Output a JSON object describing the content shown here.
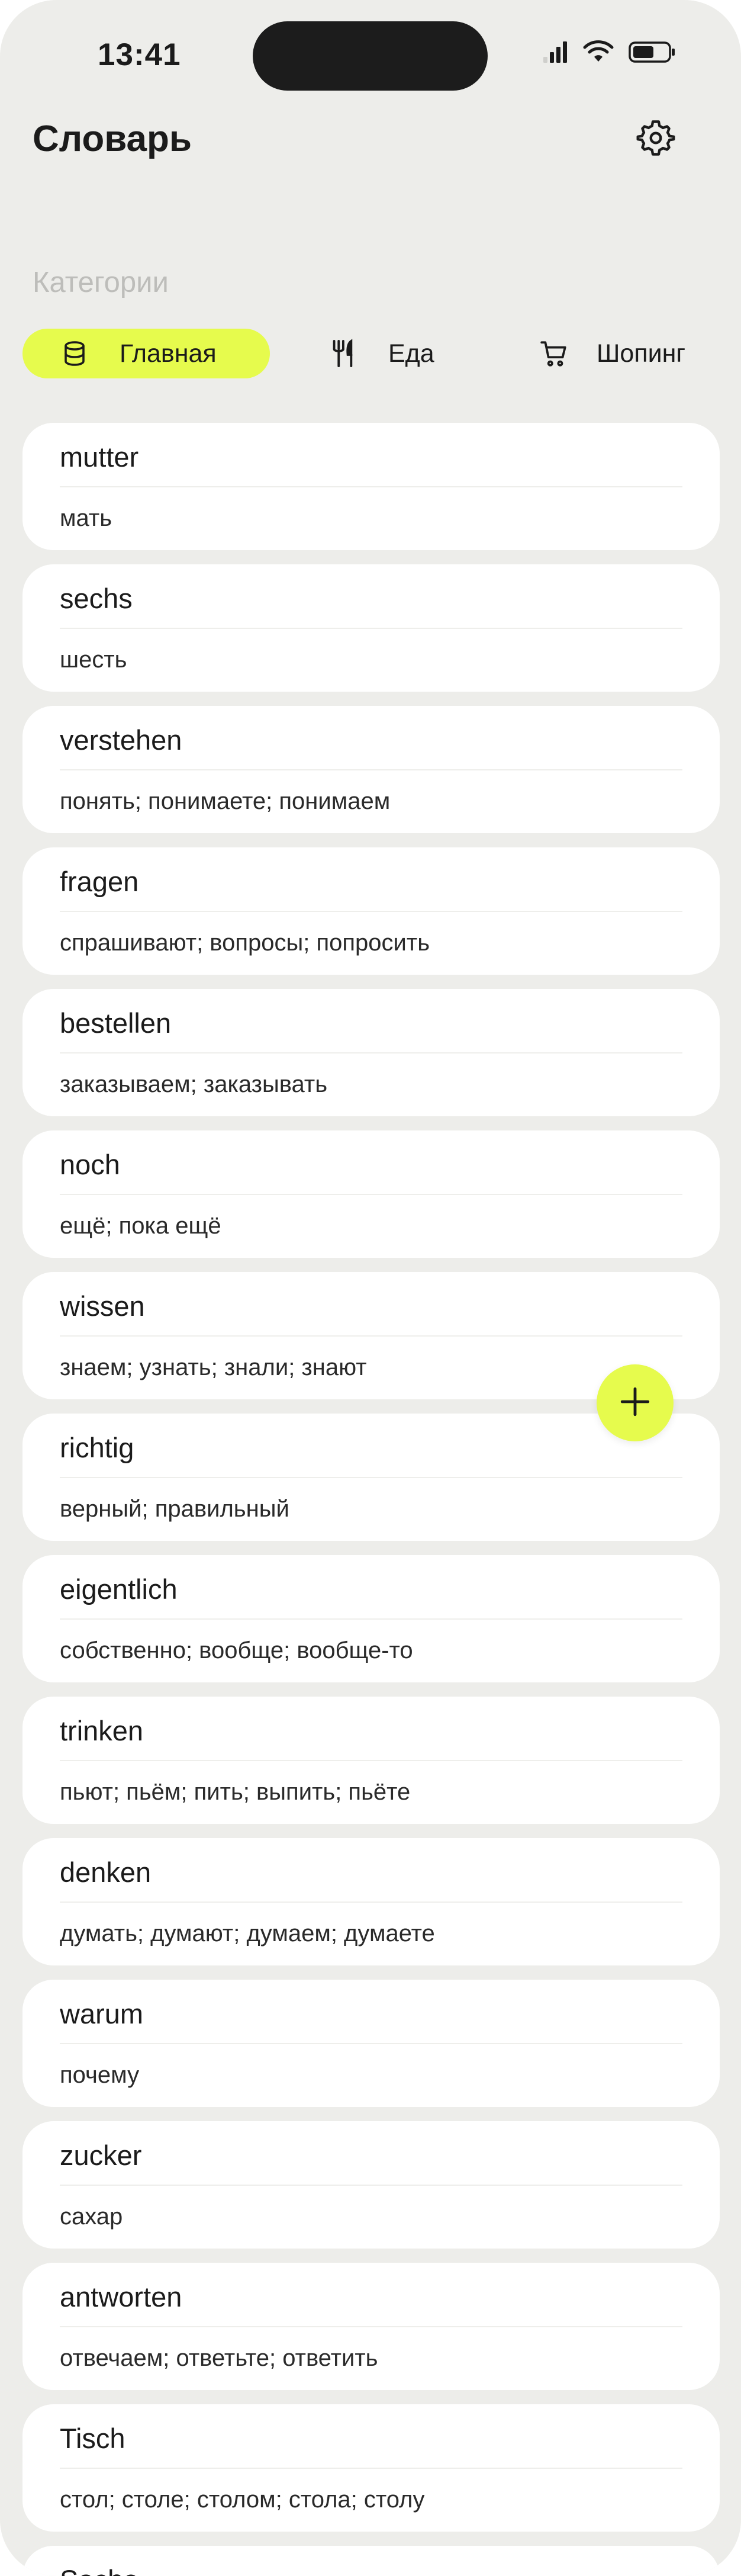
{
  "status_bar": {
    "time": "13:41",
    "icons": [
      "signal-icon",
      "wifi-icon",
      "battery-icon"
    ]
  },
  "header": {
    "title": "Словарь",
    "settings_icon": "gear-icon"
  },
  "categories": {
    "label": "Категории",
    "items": [
      {
        "label": "Главная",
        "icon": "database-icon",
        "active": true
      },
      {
        "label": "Еда",
        "icon": "fork-knife-icon",
        "active": false
      },
      {
        "label": "Шопинг",
        "icon": "cart-icon",
        "active": false
      }
    ]
  },
  "words": [
    {
      "term": "mutter",
      "translation": "мать"
    },
    {
      "term": "sechs",
      "translation": "шесть"
    },
    {
      "term": "verstehen",
      "translation": "понять; понимаете; понимаем"
    },
    {
      "term": "fragen",
      "translation": "спрашивают; вопросы; попросить"
    },
    {
      "term": "bestellen",
      "translation": "заказываем; заказывать"
    },
    {
      "term": "noch",
      "translation": "ещё; пока ещё"
    },
    {
      "term": "wissen",
      "translation": "знаем; узнать; знали; знают"
    },
    {
      "term": "richtig",
      "translation": "верный; правильный"
    },
    {
      "term": "eigentlich",
      "translation": "собственно; вообще; вообще-то"
    },
    {
      "term": "trinken",
      "translation": "пьют; пьём; пить; выпить; пьёте"
    },
    {
      "term": "denken",
      "translation": "думать; думают; думаем; думаете"
    },
    {
      "term": "warum",
      "translation": "почему"
    },
    {
      "term": "zucker",
      "translation": "сахар"
    },
    {
      "term": "antworten",
      "translation": "отвечаем; ответьте; ответить"
    },
    {
      "term": "Tisch",
      "translation": "стол; столе; столом; стола; столу"
    },
    {
      "term": "Sache",
      "translation": ""
    }
  ],
  "fab": {
    "icon": "plus-icon"
  },
  "colors": {
    "background": "#ededea",
    "accent": "#e6fb4d",
    "card": "#ffffff",
    "text": "#1b1b1b",
    "muted": "#bdbdba"
  }
}
